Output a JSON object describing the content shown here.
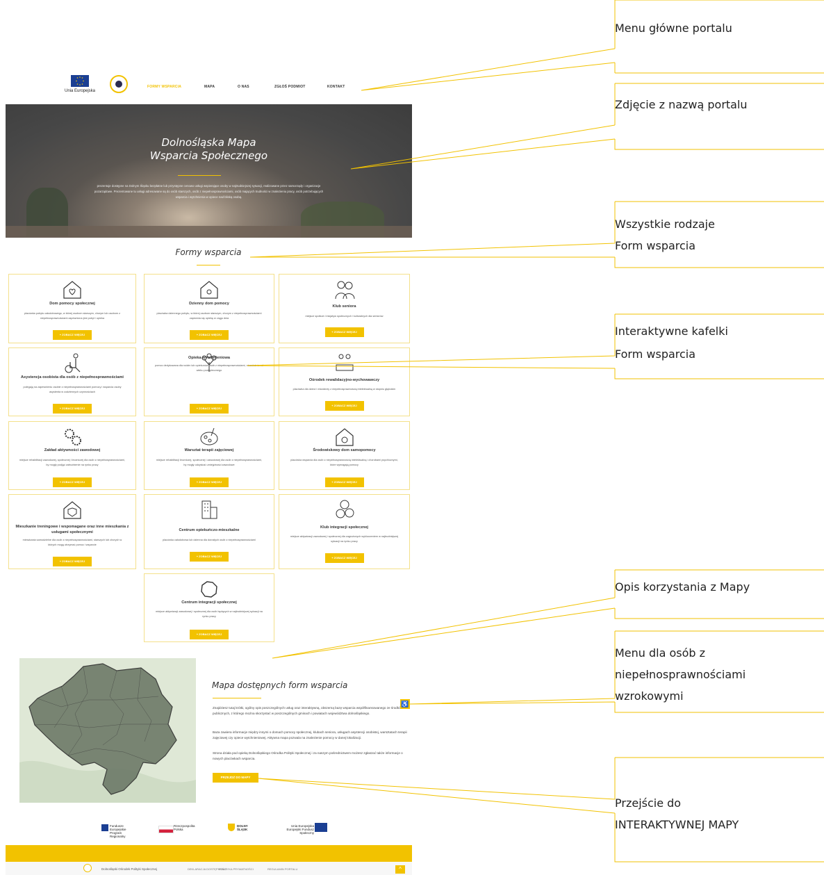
{
  "header": {
    "eu_label": "Unia Europejska",
    "nav": [
      "FORMY WSPARCIA",
      "MAPA",
      "O NAS",
      "ZGŁOŚ PODMIOT",
      "KONTAKT"
    ]
  },
  "hero": {
    "title_line1": "Dolnośląska Mapa",
    "title_line2": "Wsparcia Społecznego",
    "description": "prezentuje dostępne na Dolnym Śląsku bezpłatne lub przystępne cenowo usługi wspierające osoby w najtrudniejszej sytuacji, realizowane przez samorządy i organizacje pozarządowe. Prezentowane tu usługi adresowane są do osób starszych, osób z niepełnosprawnościami, osób mających trudności w znalezieniu pracy, osób potrzebujących wsparcia i wytchnienia w opiece nad bliską osobą."
  },
  "section": {
    "title": "Formy wsparcia"
  },
  "cards": [
    {
      "title": "Dom pomocy społecznej",
      "desc": "placówka pobytu całodobowego, w której osobom starszym, chorym lub osobom z niepełnosprawnościami zapewniona jest pobyt i opieka",
      "button": "ZOBACZ WIĘCEJ"
    },
    {
      "title": "Dzienny dom pomocy",
      "desc": "placówka dziennego pobytu, w której osobom starszym, chorym z niepełnosprawnościami zapewnia się opiekę w ciągu dnia",
      "button": "ZOBACZ WIĘCEJ"
    },
    {
      "title": "Klub seniora",
      "desc": "miejsce spotkań i inicjatyw społecznych i kulturalnych dla seniorów",
      "button": "ZOBACZ WIĘCEJ"
    },
    {
      "title": "Asystencja osobista dla osób z niepełnosprawnościami",
      "desc": "polegają na zapewnieniu osobie z niepełnosprawnościami pomocy i wsparcia osoby asystenta w codziennych czynnościach",
      "button": "ZOBACZ WIĘCEJ"
    },
    {
      "title": "Opieka wytchnieniowa",
      "desc": "pomoc dedykowana dla rodzin lub opiekunów osób z niepełnosprawnościami, niezależnie od wieku podopiecznego",
      "button": "ZOBACZ WIĘCEJ"
    },
    {
      "title": "Ośrodek rewalidacyjno-wychowawczy",
      "desc": "placówka dla dzieci i młodzieży z niepełnosprawnością intelektualną w stopniu głębokim",
      "button": "ZOBACZ WIĘCEJ"
    },
    {
      "title": "Zakład aktywności zawodowej",
      "desc": "miejsce rehabilitacji zawodowej, społecznej i leczniczej dla osób z niepełnosprawnościami, by mogły podjąć zatrudnienie na rynku pracy",
      "button": "ZOBACZ WIĘCEJ"
    },
    {
      "title": "Warsztat terapii zajęciowej",
      "desc": "miejsce rehabilitacji leczniczej, społecznej i zawodowej dla osób z niepełnosprawnościami, by mogły odzyskać umiejętności zawodowe",
      "button": "ZOBACZ WIĘCEJ"
    },
    {
      "title": "Środowiskowy dom samopomocy",
      "desc": "placówka wsparcia dla osób z niepełnosprawnością intelektualną i chorobami psychicznymi, które wymagają pomocy",
      "button": "ZOBACZ WIĘCEJ"
    },
    {
      "title": "Mieszkanie treningowe i wspomagane oraz inne mieszkania z usługami społecznymi",
      "desc": "mieszkania samodzielne dla osób z niepełnosprawnościami, starszych lub chorych w których mogą otrzymać pomoc i wsparcie",
      "button": "ZOBACZ WIĘCEJ"
    },
    {
      "title": "Centrum opiekuńczo-mieszkalne",
      "desc": "placówka całodobowa lub dzienna dla dorosłych osób z niepełnosprawnościami",
      "button": "ZOBACZ WIĘCEJ"
    },
    {
      "title": "Klub integracji społecznej",
      "desc": "miejsce aktywizacji zawodowej i społecznej dla zagrożonych wykluczeniem w najtrudniejszej sytuacji na rynku pracy",
      "button": "ZOBACZ WIĘCEJ"
    },
    {
      "title": "Centrum integracji społecznej",
      "desc": "miejsce aktywizacji zawodowej i społecznej dla osób będących w najtrudniejszej sytuacji na rynku pracy",
      "button": "ZOBACZ WIĘCEJ"
    }
  ],
  "map_section": {
    "title": "Mapa dostępnych form wsparcia",
    "p1": "Znajdziesz tutaj krótki, ogólny opis poszczególnych usług oraz interaktywną, obszerną bazę wsparcia współfinansowanego ze środków publicznych, z którego można skorzystać w poszczególnych gminach i powiatach województwa dolnośląskiego.",
    "p2": "Baza zawiera informacje między innymi o domach pomocy społecznej, klubach seniora, usługach asystencji osobistej, warsztatach terapii zajęciowej czy opiece wytchnieniowej. Aktywna mapa pozwala na znalezienie pomocy w danej lokalizacji.",
    "p3": "Strona działa pod opieką Dolnośląskiego Ośrodka Polityki Społecznej i za naszym pośrednictwem możesz zgłaszać także informacje o nowych placówkach wsparcia.",
    "button": "PRZEJDŹ DO MAPY",
    "accessibility_icon": "♿"
  },
  "logos": {
    "fe": "Fundusze Europejskie Program Regionalny",
    "rp": "Rzeczpospolita Polska",
    "ds": "DOLNY ŚLĄSK",
    "ue": "Unia Europejska Europejski Fundusz Społeczny"
  },
  "footer": {
    "org": "Dolnośląski Ośrodek Polityki Społecznej",
    "links": [
      "DEKLARACJA DOSTĘPNOŚCI",
      "POLITYKA PRYWATNOŚCI",
      "REGULAMIN PORTALU"
    ],
    "up": "^"
  },
  "annotations": [
    "Menu główne portalu",
    "Zdjęcie z nazwą portalu",
    "Wszystkie rodzaje",
    "Form wsparcia",
    "Interaktywne kafelki",
    "Form wsparcia",
    "Opis korzystania z Mapy",
    "Menu dla osób z",
    "niepełnosprawnościami",
    "wzrokowymi",
    "Przejście do",
    "INTERAKTYWNEJ MAPY"
  ],
  "colors": {
    "accent": "#f2c200",
    "card_border": "#f4e08a"
  }
}
